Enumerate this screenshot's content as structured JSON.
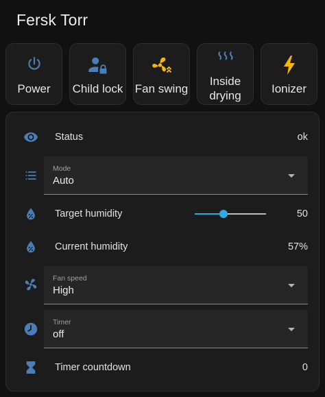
{
  "header": {
    "title": "Fersk Torr"
  },
  "buttons": [
    {
      "label": "Power",
      "icon": "power-icon",
      "color": "#4a7fb5"
    },
    {
      "label": "Child lock",
      "icon": "account-lock-icon",
      "color": "#4a7fb5"
    },
    {
      "label": "Fan swing",
      "icon": "fan-swing-icon",
      "color": "#f5b800"
    },
    {
      "label_line1": "Inside",
      "label_line2": "drying",
      "icon": "heat-waves-icon",
      "color": "#4a7fb5"
    },
    {
      "label": "Ionizer",
      "icon": "lightning-bolt-icon",
      "color": "#f5b800"
    }
  ],
  "entities": {
    "status": {
      "label": "Status",
      "value": "ok",
      "icon": "eye-icon"
    },
    "mode": {
      "label": "Mode",
      "value": "Auto",
      "icon": "list-icon"
    },
    "target_humidity": {
      "label": "Target humidity",
      "value": "50",
      "fraction": 0.4,
      "icon": "water-percent-icon"
    },
    "current_humidity": {
      "label": "Current humidity",
      "value": "57%",
      "icon": "water-percent-icon"
    },
    "fan_speed": {
      "label": "Fan speed",
      "value": "High",
      "icon": "fan-icon"
    },
    "timer": {
      "label": "Timer",
      "value": "off",
      "icon": "clock-icon"
    },
    "timer_countdown": {
      "label": "Timer countdown",
      "value": "0",
      "icon": "hourglass-icon"
    }
  },
  "colors": {
    "accent": "#2ea8e6",
    "icon_blue": "#4a7fb5",
    "icon_active": "#f5b800"
  }
}
